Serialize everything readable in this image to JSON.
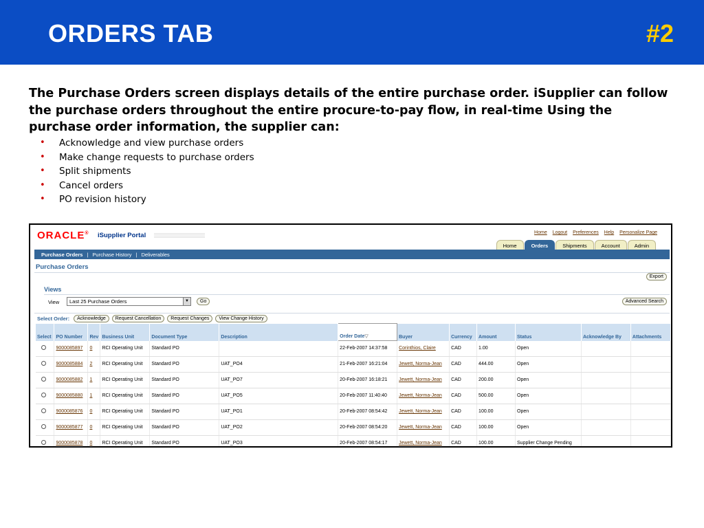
{
  "slide": {
    "title": "ORDERS TAB",
    "number": "#2",
    "intro": "The Purchase Orders screen displays details of the entire purchase order. iSupplier can follow the purchase orders throughout the entire procure-to-pay flow, in real-time Using the purchase order information, the supplier can:",
    "bullets": [
      "Acknowledge and view purchase orders",
      "Make change requests to purchase orders",
      "Split shipments",
      "Cancel orders",
      "PO revision history"
    ]
  },
  "app": {
    "logo": "ORACLE",
    "portal_name": "iSupplier Portal",
    "global_links": [
      "Home",
      "Logout",
      "Preferences",
      "Help",
      "Personalize Page"
    ],
    "tabs": [
      "Home",
      "Orders",
      "Shipments",
      "Account",
      "Admin"
    ],
    "active_tab": "Orders",
    "subnav": [
      "Purchase Orders",
      "Purchase History",
      "Deliverables"
    ],
    "subnav_separator": "|",
    "page_heading": "Purchase Orders",
    "export_label": "Export",
    "views_label": "Views",
    "view_label": "View",
    "view_selected": "Last 25 Purchase Orders",
    "go_label": "Go",
    "advanced_search_label": "Advanced Search",
    "select_order_label": "Select Order:",
    "action_buttons": [
      "Acknowledge",
      "Request Cancellation",
      "Request Changes",
      "View Change History"
    ],
    "sort_indicator": "▽",
    "columns": [
      "Select",
      "PO Number",
      "Rev",
      "Business Unit",
      "Document Type",
      "Description",
      "Order Date",
      "Buyer",
      "Currency",
      "Amount",
      "Status",
      "Acknowledge By",
      "Attachments"
    ],
    "rows": [
      {
        "po": "9000085897",
        "rev": "0",
        "bu": "RCI Operating Unit",
        "doc": "Standard PO",
        "desc": "",
        "date": "22-Feb-2007 14:37:58",
        "buyer": "Corinthios, Claire",
        "cur": "CAD",
        "amt": "1.00",
        "status": "Open",
        "ack": "",
        "att": ""
      },
      {
        "po": "9000085884",
        "rev": "2",
        "bu": "RCI Operating Unit",
        "doc": "Standard PO",
        "desc": "UAT_PO4",
        "date": "21-Feb-2007 16:21:04",
        "buyer": "Jewett, Norma-Jean",
        "cur": "CAD",
        "amt": "444.00",
        "status": "Open",
        "ack": "",
        "att": ""
      },
      {
        "po": "9000085882",
        "rev": "1",
        "bu": "RCI Operating Unit",
        "doc": "Standard PO",
        "desc": "UAT_PO7",
        "date": "20-Feb-2007 16:18:21",
        "buyer": "Jewett, Norma-Jean",
        "cur": "CAD",
        "amt": "200.00",
        "status": "Open",
        "ack": "",
        "att": ""
      },
      {
        "po": "9000085880",
        "rev": "1",
        "bu": "RCI Operating Unit",
        "doc": "Standard PO",
        "desc": "UAT_PO5",
        "date": "20-Feb-2007 11:40:40",
        "buyer": "Jewett, Norma-Jean",
        "cur": "CAD",
        "amt": "500.00",
        "status": "Open",
        "ack": "",
        "att": ""
      },
      {
        "po": "9000085876",
        "rev": "0",
        "bu": "RCI Operating Unit",
        "doc": "Standard PO",
        "desc": "UAT_PO1",
        "date": "20-Feb-2007 08:54:42",
        "buyer": "Jewett, Norma-Jean",
        "cur": "CAD",
        "amt": "100.00",
        "status": "Open",
        "ack": "",
        "att": ""
      },
      {
        "po": "9000085877",
        "rev": "0",
        "bu": "RCI Operating Unit",
        "doc": "Standard PO",
        "desc": "UAT_PO2",
        "date": "20-Feb-2007 08:54:20",
        "buyer": "Jewett, Norma-Jean",
        "cur": "CAD",
        "amt": "100.00",
        "status": "Open",
        "ack": "",
        "att": ""
      },
      {
        "po": "9000085878",
        "rev": "0",
        "bu": "RCI Operating Unit",
        "doc": "Standard PO",
        "desc": "UAT_PO3",
        "date": "20-Feb-2007 08:54:17",
        "buyer": "Jewett, Norma-Jean",
        "cur": "CAD",
        "amt": "100.00",
        "status": "Supplier Change Pending",
        "ack": "",
        "att": ""
      }
    ]
  },
  "colors": {
    "slide_header_bg": "#0b4dc4",
    "slide_number": "#ffcc00",
    "bullet": "#cc0000",
    "app_blue": "#336699",
    "link": "#663300",
    "oracle_red": "#ff0000"
  }
}
